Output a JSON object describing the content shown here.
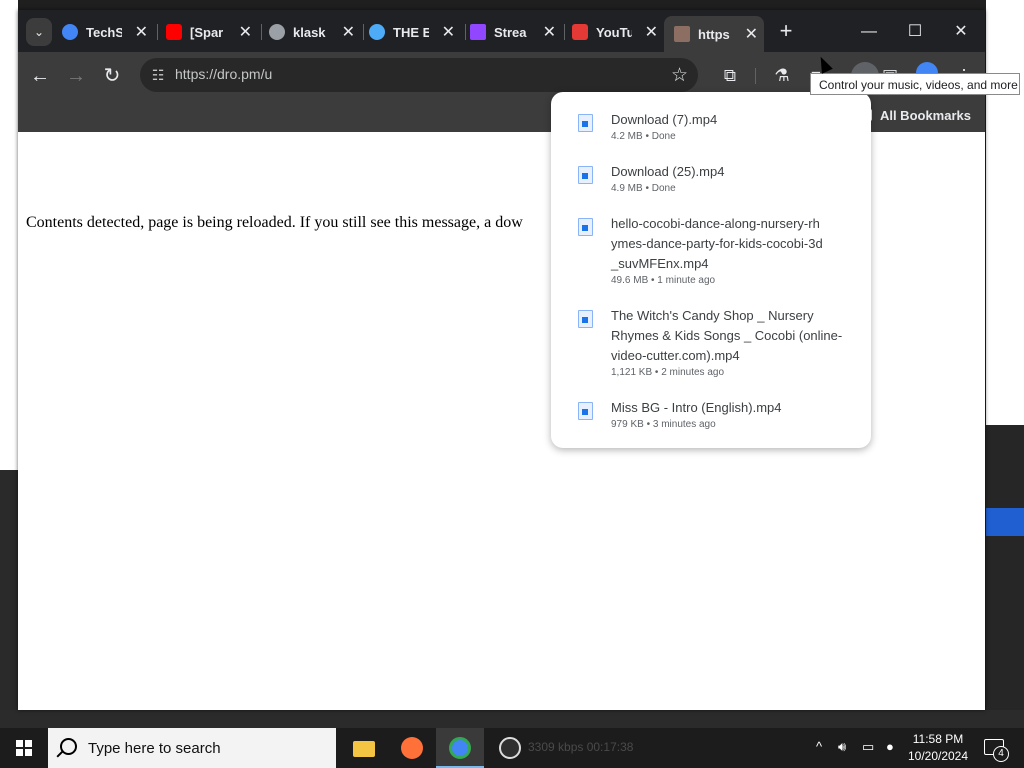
{
  "window": {
    "tabs": [
      {
        "title": "TechS",
        "fav_color": "#4285f4"
      },
      {
        "title": "[Spar",
        "fav_color": "#ff0000"
      },
      {
        "title": "klask",
        "fav_color": "#9aa0a6"
      },
      {
        "title": "THE E",
        "fav_color": "#4dabf7"
      },
      {
        "title": "Strea",
        "fav_color": "#9146ff"
      },
      {
        "title": "YouTu",
        "fav_color": "#e53935"
      },
      {
        "title": "https",
        "fav_color": "#8d6e63"
      }
    ],
    "new_tab_symbol": "+",
    "controls": {
      "minimize": "—",
      "maximize": "☐",
      "close": "✕"
    }
  },
  "toolbar": {
    "url": "https://dro.pm/u",
    "bookmarks_label": "All Bookmarks"
  },
  "tooltip": "Control your music, videos, and more",
  "page": {
    "message": "Contents detected, page is being reloaded. If you still see this message, a dow"
  },
  "downloads": [
    {
      "name": "Download (7).mp4",
      "meta": "4.2 MB • Done"
    },
    {
      "name": "Download (25).mp4",
      "meta": "4.9 MB • Done"
    },
    {
      "name": "hello-cocobi-dance-along-nursery-rhymes-dance-party-for-kids-cocobi-3d_suvMFEnx.mp4",
      "meta": "49.6 MB • 1 minute ago"
    },
    {
      "name": "The Witch's Candy Shop _ Nursery Rhymes & Kids Songs _ Cocobi (online-video-cutter.com).mp4",
      "meta": "1,121 KB • 2 minutes ago"
    },
    {
      "name": "Miss BG - Intro (English).mp4",
      "meta": "979 KB • 3 minutes ago"
    }
  ],
  "taskbar": {
    "search_placeholder": "Type here to search",
    "tray_text": "3309 kbps   00:17:38",
    "time": "11:58 PM",
    "date": "10/20/2024",
    "notifications": "4"
  },
  "colors": {
    "accent": "#1a73e8",
    "taskbar_highlight": "#76b9ed"
  }
}
